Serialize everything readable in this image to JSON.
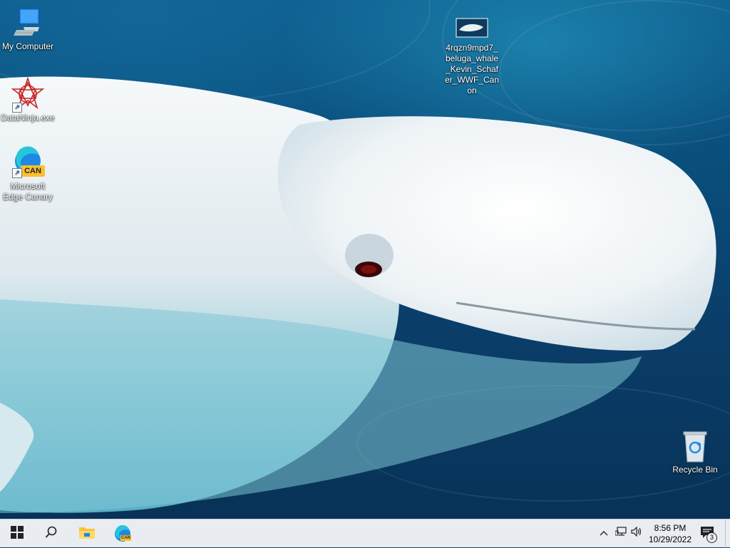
{
  "desktop": {
    "icons": [
      {
        "label": "My Computer",
        "icon": "monitor-icon"
      },
      {
        "label": "DataNinja.exe",
        "icon": "red-star-icon"
      },
      {
        "label": "Microsoft Edge Canary",
        "icon": "edge-canary-icon",
        "badge": "CAN"
      },
      {
        "label": "4rqzn9mpd7_beluga_whale_Kevin_Schafer_WWF_Canon",
        "icon": "image-file-icon"
      },
      {
        "label": "Recycle Bin",
        "icon": "recycle-bin-icon"
      }
    ]
  },
  "taskbar": {
    "start": "windows-logo-icon",
    "search": "search-icon",
    "file_explorer": "folder-icon",
    "edge_canary": "edge-canary-icon",
    "edge_badge": "CAN",
    "tray": [
      "chevron-up-icon",
      "network-icon",
      "volume-icon"
    ],
    "clock": {
      "time": "8:56 PM",
      "date": "10/29/2022"
    },
    "notifications": {
      "icon": "notification-icon",
      "count": "3"
    }
  },
  "colors": {
    "wallpaper_water": "#0a4f7d",
    "taskbar_bg": "#e9edf1",
    "whale": "#f2f6f8"
  }
}
